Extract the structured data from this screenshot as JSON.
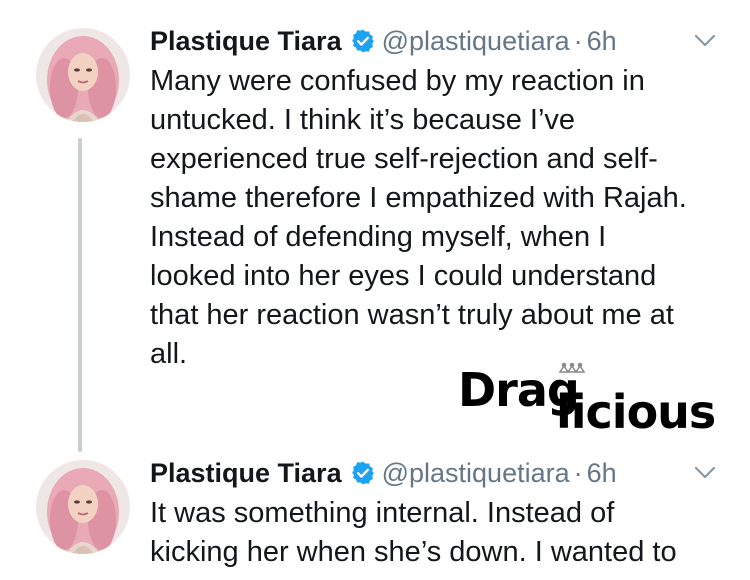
{
  "tweets": [
    {
      "display_name": "Plastique Tiara",
      "handle": "@plastiquetiara",
      "separator": "·",
      "time": "6h",
      "lines": [
        "Many were confused by my reaction in",
        "untucked. I think it’s because I’ve",
        "experienced true self-rejection and self-",
        "shame therefore I empathized with Rajah.",
        "Instead of defending myself, when I",
        "looked into her eyes I could understand",
        "that her reaction wasn’t truly about me at",
        "all."
      ]
    },
    {
      "display_name": "Plastique Tiara",
      "handle": "@plastiquetiara",
      "separator": "·",
      "time": "6h",
      "lines": [
        "It was something internal. Instead of",
        "kicking her when she’s down. I wanted to"
      ]
    }
  ],
  "watermark": {
    "text_part1": "Drag",
    "text_part2": "licious",
    "color": "#8a8a8a"
  },
  "colors": {
    "verified_badge": "#1da1f2",
    "secondary_text": "#657786",
    "thread_line": "#c4cfd6"
  },
  "icons": {
    "verified": "verified-badge-icon",
    "more": "chevron-down-icon"
  }
}
